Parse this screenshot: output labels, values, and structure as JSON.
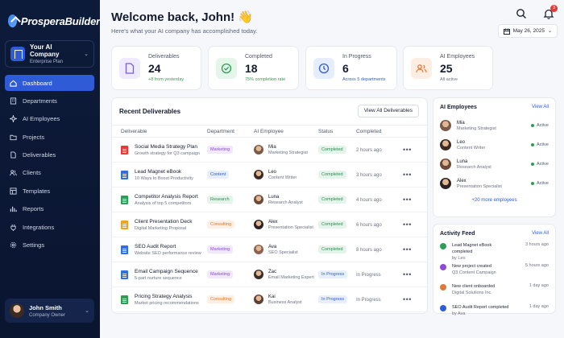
{
  "brand": {
    "name": "ProsperaBuilder"
  },
  "company": {
    "name": "Your AI Company",
    "plan": "Enterprise Plan"
  },
  "nav": [
    {
      "label": "Dashboard",
      "icon": "home-icon",
      "active": true
    },
    {
      "label": "Departments",
      "icon": "building-icon"
    },
    {
      "label": "AI Employees",
      "icon": "ai-sparkle-icon"
    },
    {
      "label": "Projects",
      "icon": "folder-icon"
    },
    {
      "label": "Deliverables",
      "icon": "document-icon"
    },
    {
      "label": "Clients",
      "icon": "users-icon"
    },
    {
      "label": "Templates",
      "icon": "template-icon"
    },
    {
      "label": "Reports",
      "icon": "chart-icon"
    },
    {
      "label": "Integrations",
      "icon": "plug-icon"
    },
    {
      "label": "Settings",
      "icon": "gear-icon"
    }
  ],
  "user": {
    "name": "John Smith",
    "role": "Company Owner"
  },
  "header": {
    "welcome": "Welcome back, John! 👋",
    "subtitle": "Here's what your AI company has accomplished today.",
    "notifications": "3",
    "date": "May 26, 2025"
  },
  "stats": [
    {
      "label": "Deliverables",
      "value": "24",
      "sub": "+8 from yesterday",
      "icon": "document-icon",
      "color": "#7c5cd6",
      "bg": "#efeafd"
    },
    {
      "label": "Completed",
      "value": "18",
      "sub": "75% completion rate",
      "icon": "check-circle-icon",
      "color": "#2e9e57",
      "bg": "#e4f5ea"
    },
    {
      "label": "In Progress",
      "value": "6",
      "sub": "Across 5 departments",
      "icon": "clock-icon",
      "color": "#2f5bd7",
      "bg": "#e6edfc"
    },
    {
      "label": "AI Employees",
      "value": "25",
      "sub": "All active",
      "icon": "users-icon",
      "color": "#e07a3b",
      "bg": "#fdeee3"
    }
  ],
  "deliverables": {
    "title": "Recent Deliverables",
    "button": "View All Deliverables",
    "columns": [
      "Deliverable",
      "Department",
      "AI Employee",
      "Status",
      "Completed"
    ],
    "rows": [
      {
        "title": "Social Media Strategy Plan",
        "sub": "Growth strategy for Q3 campaign",
        "file_color": "#e53935",
        "dept": "Marketing",
        "dept_fg": "#8e4ad6",
        "dept_bg": "#f1e8fc",
        "emp": "Mia",
        "emp_role": "Marketing Strategist",
        "status": "Completed",
        "time": "2 hours ago"
      },
      {
        "title": "Lead Magnet eBook",
        "sub": "10 Ways to Boost Productivity",
        "file_color": "#2f6fe0",
        "dept": "Content",
        "dept_fg": "#2f5bd7",
        "dept_bg": "#e6edfc",
        "emp": "Leo",
        "emp_role": "Content Writer",
        "status": "Completed",
        "time": "3 hours ago"
      },
      {
        "title": "Competitor Analysis Report",
        "sub": "Analysis of top 5 competitors",
        "file_color": "#2e9e57",
        "dept": "Research",
        "dept_fg": "#2e8a4f",
        "dept_bg": "#e4f4ea",
        "emp": "Luna",
        "emp_role": "Research Analyst",
        "status": "Completed",
        "time": "4 hours ago"
      },
      {
        "title": "Client Presentation Deck",
        "sub": "Digital Marketing Proposal",
        "file_color": "#f0a323",
        "dept": "Consulting",
        "dept_fg": "#d9772c",
        "dept_bg": "#fdefe3",
        "emp": "Alex",
        "emp_role": "Presentation Specialist",
        "status": "Completed",
        "time": "6 hours ago"
      },
      {
        "title": "SEO Audit Report",
        "sub": "Website SEO performance review",
        "file_color": "#2f6fe0",
        "dept": "Marketing",
        "dept_fg": "#8e4ad6",
        "dept_bg": "#f1e8fc",
        "emp": "Ava",
        "emp_role": "SEO Specialist",
        "status": "Completed",
        "time": "8 hours ago"
      },
      {
        "title": "Email Campaign Sequence",
        "sub": "5-part nurture sequence",
        "file_color": "#2f6fe0",
        "dept": "Marketing",
        "dept_fg": "#8e4ad6",
        "dept_bg": "#f1e8fc",
        "emp": "Zac",
        "emp_role": "Email Marketing Expert",
        "status": "In Progress",
        "time": "In Progress"
      },
      {
        "title": "Pricing Strategy Analysis",
        "sub": "Market pricing recommendations",
        "file_color": "#2e9e57",
        "dept": "Consulting",
        "dept_fg": "#d9772c",
        "dept_bg": "#fdefe3",
        "emp": "Kai",
        "emp_role": "Business Analyst",
        "status": "In Progress",
        "time": "In Progress"
      }
    ]
  },
  "ai_employees": {
    "title": "AI Employees",
    "link": "View All",
    "items": [
      {
        "name": "Mia",
        "role": "Marketing Strategist",
        "status": "Active"
      },
      {
        "name": "Leo",
        "role": "Content Writer",
        "status": "Active"
      },
      {
        "name": "Luna",
        "role": "Research Analyst",
        "status": "Active"
      },
      {
        "name": "Alex",
        "role": "Presentation Specialist",
        "status": "Active"
      }
    ],
    "more": "+20 more employees"
  },
  "activity": {
    "title": "Activity Feed",
    "link": "View All",
    "items": [
      {
        "main": "Lead Magnet eBook completed",
        "sub": "by Leo",
        "time": "3 hours ago",
        "color": "#2e9e57",
        "icon": "check-icon"
      },
      {
        "main": "New project created",
        "sub": "Q3 Content Campaign",
        "time": "5 hours ago",
        "color": "#8e4ad6",
        "icon": "document-icon"
      },
      {
        "main": "New client onboarded",
        "sub": "Digital Solutions Inc.",
        "time": "1 day ago",
        "color": "#e07a3b",
        "icon": "user-icon"
      },
      {
        "main": "SEO Audit Report completed",
        "sub": "by Ava",
        "time": "1 day ago",
        "color": "#2f5bd7",
        "icon": "check-icon"
      }
    ]
  }
}
